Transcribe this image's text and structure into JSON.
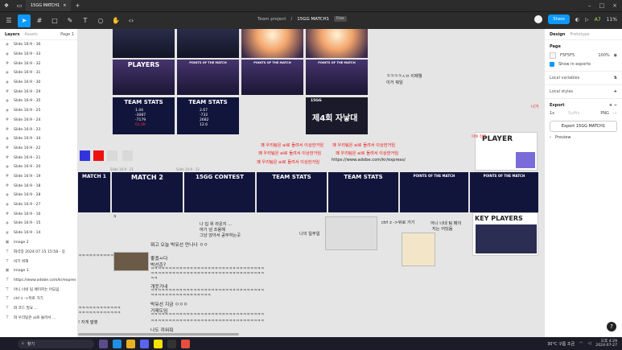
{
  "titlebar": {
    "tab_label": "15GG MATCH1",
    "plus": "+"
  },
  "toolbar": {
    "breadcrumb_team": "Team project",
    "breadcrumb_sep": "/",
    "file_name": "15GG MATCH1",
    "plan_badge": "Free",
    "share_label": "Share",
    "zoom": "11%",
    "play_icon": "play-icon",
    "counter": "A7"
  },
  "left_panel": {
    "tab_layers": "Layers",
    "tab_assets": "Assets",
    "page_label": "Page 1",
    "layers": [
      {
        "icon": "frame",
        "label": "Slide 16:9 - 36"
      },
      {
        "icon": "frame",
        "label": "Slide 16:9 - 33"
      },
      {
        "icon": "frame",
        "label": "Slide 16:9 - 32"
      },
      {
        "icon": "frame",
        "label": "Slide 16:9 - 31"
      },
      {
        "icon": "frame",
        "label": "Slide 16:9 - 30"
      },
      {
        "icon": "frame",
        "label": "Slide 16:9 - 29"
      },
      {
        "icon": "frame",
        "label": "Slide 16:9 - 35"
      },
      {
        "icon": "frame",
        "label": "Slide 16:9 - 25"
      },
      {
        "icon": "frame",
        "label": "Slide 16:9 - 24"
      },
      {
        "icon": "frame",
        "label": "Slide 16:9 - 23"
      },
      {
        "icon": "frame",
        "label": "Slide 16:9 - 34"
      },
      {
        "icon": "frame",
        "label": "Slide 16:9 - 22"
      },
      {
        "icon": "frame",
        "label": "Slide 16:9 - 21"
      },
      {
        "icon": "frame",
        "label": "Slide 16:9 - 20"
      },
      {
        "icon": "frame",
        "label": "Slide 16:9 - 19"
      },
      {
        "icon": "frame",
        "label": "Slide 16:9 - 18"
      },
      {
        "icon": "frame",
        "label": "Slide 16:9 - 28"
      },
      {
        "icon": "frame",
        "label": "Slide 16:9 - 27"
      },
      {
        "icon": "frame",
        "label": "Slide 16:9 - 16"
      },
      {
        "icon": "frame",
        "label": "Slide 16:9 - 15"
      },
      {
        "icon": "frame",
        "label": "Slide 16:9 - 14"
      },
      {
        "icon": "image",
        "label": "image 2"
      },
      {
        "icon": "text",
        "label": "화각장 2024.07.15 15:58 - 응"
      },
      {
        "icon": "text",
        "label": "비기 위해"
      },
      {
        "icon": "image",
        "label": "image 1"
      },
      {
        "icon": "text",
        "label": "https://www.adobe.com/kr/expres"
      },
      {
        "icon": "text",
        "label": "아니 너네 팀 페이커는 어딨음"
      },
      {
        "icon": "text",
        "label": "ctrl z ->뒤로 가기"
      },
      {
        "icon": "text",
        "label": "와 코드 필요 ..."
      },
      {
        "icon": "text",
        "label": "와 우리팀은 ai로 돌려서 ..."
      }
    ]
  },
  "canvas": {
    "slide_label_a": "Slide 16:9 - 21",
    "slide_label_b": "Slide 16:9 - 22",
    "slides_top": [
      {
        "title": ""
      },
      {
        "title": ""
      },
      {
        "title": ""
      },
      {
        "title": ""
      },
      {
        "title": "PLAYERS"
      },
      {
        "title": "POINTS OF THE MATCH"
      },
      {
        "title": "POINTS OF THE MATCH"
      },
      {
        "title": "POINTS OF THE MATCH"
      },
      {
        "title": "TEAM STATS"
      },
      {
        "title": "TEAM STATS"
      },
      {
        "title": ""
      },
      {
        "title": "15GG"
      }
    ],
    "stats_a": {
      "v1": "1.44",
      "v2": "-3087",
      "v3": "-7179",
      "v4": "61.0K"
    },
    "stats_b": {
      "v1": "2.67",
      "v2": "-732",
      "v3": "2682",
      "v4": "12.6"
    },
    "closing_slide": "제4회 자낳대",
    "slides_mid": [
      {
        "title": "MATCH 1"
      },
      {
        "title": "MATCH 2"
      },
      {
        "title": "15GG CONTEST"
      },
      {
        "title": "TEAM STATS"
      },
      {
        "title": "TEAM STATS"
      },
      {
        "title": "POINTS OF THE MATCH"
      },
      {
        "title": "POINTS OF THE MATCH"
      }
    ],
    "player_slide": "PLAYER",
    "key_players": "KEY PLAYERS",
    "notes": {
      "n1": "ㅋㅋㅋㅋㅅㅂ 이제뭘",
      "n2": "이거 뭐임",
      "red_line": "꽤 우리팀은 ai로 돌려서 이상한거임",
      "url": "https://www.adobe.com/kr/express/",
      "n3": "ㅋ",
      "n4": "나 집 위 라운지 ...",
      "n5": "여기 넘 조용해",
      "n6": "그냥 앉아서 공부하는곳",
      "n7": "나의 일주일",
      "n8": "ctrl z ->뒤로 가기",
      "n9": "아니 너네 팀 페이",
      "n10": "지는 어딨음",
      "n11": "뭐고 오늘 박유선 만나나 ㅇㅇ",
      "n12": "좋겠ㅆ다",
      "n13": "박선준?",
      "n14": "개웃기네",
      "n15": "박유선 지금 ㅇㅇㅇ",
      "n16": "거제도임",
      "n17": "나도 끼워줘",
      "n18": "! 지게 말했",
      "n19": "너거",
      "n20": "아예 정리"
    },
    "kk_short": "ㅋㅋㅋㅋㅋㅋㅋㅋㅋㅋㅋㅋ",
    "kk_long": "ㅋㅋㅋㅋㅋㅋㅋㅋㅋㅋㅋㅋㅋㅋㅋㅋㅋㅋㅋㅋㅋㅋㅋㅋㅋㅋㅋㅋㅋㅋㅋㅋ",
    "kk_mid": "ㅋㅋㅋㅋㅋㅋㅋㅋㅋㅋㅋㅋㅋㅋㅋㅋㅋ",
    "kk_two": "ㅋㅋ",
    "swatches": [
      "#3333dd",
      "#ee1111",
      "#d9d9d9",
      "#d9d9d9"
    ]
  },
  "right_panel": {
    "tab_design": "Design",
    "tab_prototype": "Prototype",
    "page_title": "Page",
    "page_color": "F5F5F5",
    "page_opacity": "100%",
    "show_exports": "Show in exports",
    "local_variables": "Local variables",
    "local_styles": "Local styles",
    "export_title": "Export",
    "export_scale": "1x",
    "export_suffix": "Suffix",
    "export_format": "PNG",
    "export_button": "Export 15GG MATCH1",
    "preview": "Preview"
  },
  "taskbar": {
    "search_placeholder": "찾기",
    "weather": "30°C 구름 조금",
    "time": "오후 4:29",
    "date": "2024-07-27"
  }
}
